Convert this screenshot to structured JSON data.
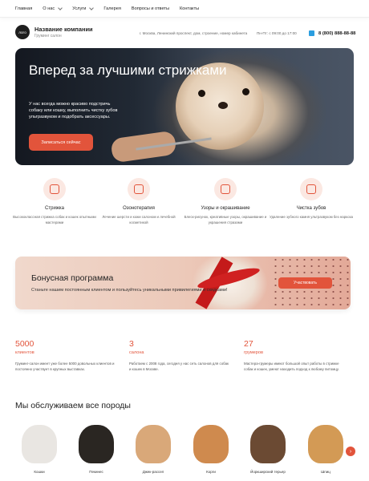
{
  "nav": {
    "items": [
      {
        "label": "Главная",
        "dropdown": false
      },
      {
        "label": "О нас",
        "dropdown": true
      },
      {
        "label": "Услуги",
        "dropdown": true
      },
      {
        "label": "Галерея",
        "dropdown": false
      },
      {
        "label": "Вопросы и ответы",
        "dropdown": false
      },
      {
        "label": "Контакты",
        "dropdown": false
      }
    ]
  },
  "header": {
    "logo_text": "логo",
    "company_name": "Название компании",
    "company_type": "Груминг салон",
    "address": "г. Москва, Ленинский проспект, дом, строение, номер кабинета",
    "hours": "Пн-Пт: с 09:00 до 17:00",
    "phone": "8 (800) 888-88-88"
  },
  "hero": {
    "title": "Вперед за лучшими стрижками",
    "subtitle": "У нас всегда можно красиво подстричь собаку или кошку, выполнить чистку зубов ультразвуком и подобрать аксессуары.",
    "cta_label": "Записаться сейчас"
  },
  "services": [
    {
      "icon": "scissors-icon",
      "title": "Стрижка",
      "desc": "Высококлассная стрижка собак и кошек опытными мастерами"
    },
    {
      "icon": "ozone-icon",
      "title": "Озонотерапия",
      "desc": "Лечение шерсти и кожи салоном и лечебной косметикой"
    },
    {
      "icon": "pattern-icon",
      "title": "Узоры и окрашивание",
      "desc": "Блеск-рисунок, креативные узоры, окрашивание и украшения стразами"
    },
    {
      "icon": "tooth-icon",
      "title": "Чистка зубов",
      "desc": "Удаление зубного камня ультразвуком без наркоза"
    }
  ],
  "bonus": {
    "title": "Бонусная программа",
    "subtitle": "Станьте нашим постоянным клиентом и пользуйтесь уникальными привилегиями и скидками!",
    "cta_label": "Участвовать"
  },
  "stats": [
    {
      "number": "5000",
      "label": "клиентов",
      "desc": "Груминг-салон имеет уже более 5000 довольных клиентов и постоянно участвует в крупных выставках."
    },
    {
      "number": "3",
      "label": "салона",
      "desc": "Работаем с 2008 года, сегодня у нас сеть салонов для собак и кошек в Москве."
    },
    {
      "number": "27",
      "label": "грумеров",
      "desc": "Мастера-грумеры имеют большой опыт работы в стрижке собак и кошек, умеют находить подход к любому питомцу."
    }
  ],
  "breeds": {
    "title": "Мы обслуживаем все породы",
    "items": [
      {
        "label": "Кошки",
        "color": "#e9e6e2"
      },
      {
        "label": "Пекинес",
        "color": "#2a2622"
      },
      {
        "label": "Джек-рассел",
        "color": "#d9a879"
      },
      {
        "label": "Корги",
        "color": "#cf8a4e"
      },
      {
        "label": "Йоркширский терьер",
        "color": "#6b4a33"
      },
      {
        "label": "Шпиц",
        "color": "#d39a55"
      }
    ],
    "next_icon": "chevron-right-icon"
  },
  "colors": {
    "accent": "#e2543b",
    "telegram": "#2b9ee0"
  }
}
